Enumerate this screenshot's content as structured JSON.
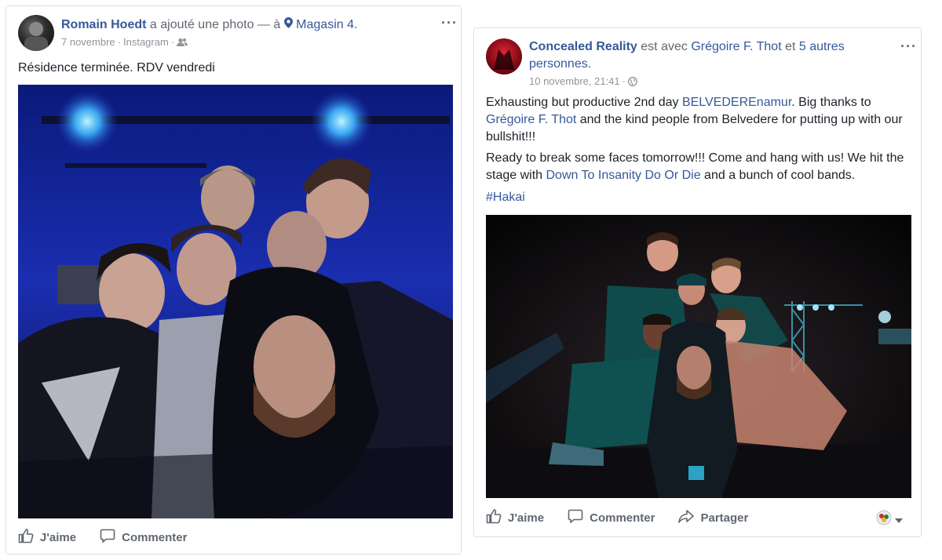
{
  "post_left": {
    "author": "Romain Hoedt",
    "action_text": "a ajouté une photo — à",
    "location": "Magasin 4.",
    "date": "7 novembre",
    "source": "Instagram",
    "text": "Résidence terminée. RDV vendredi",
    "actions": {
      "like": "J'aime",
      "comment": "Commenter"
    }
  },
  "post_right": {
    "author": "Concealed Reality",
    "with_text": "est avec",
    "tagged_person": "Grégoire F. Thot",
    "and_text": "et",
    "others": "5 autres personnes.",
    "date": "10 novembre, 21:41",
    "paragraph1": {
      "p1": "Exhausting but productive 2nd day ",
      "mention1": "BELVEDEREnamur",
      "p2": ". Big thanks to ",
      "mention2": "Grégoire F. Thot",
      "p3": " and the kind people from Belvedere for putting up with our bullshit!!!"
    },
    "paragraph2": {
      "p1": "Ready to break some faces tomorrow!!! Come and hang with us! We hit the stage with ",
      "mention": "Down To Insanity Do Or Die",
      "p2": " and a bunch of cool bands."
    },
    "hashtag": "#Hakai",
    "actions": {
      "like": "J'aime",
      "comment": "Commenter",
      "share": "Partager"
    }
  },
  "colors": {
    "link": "#365899",
    "meta": "#90949c",
    "text": "#1d2129",
    "action": "#606770"
  },
  "icons": [
    "location-pin-icon",
    "friends-audience-icon",
    "globe-icon",
    "like-icon",
    "comment-icon",
    "share-icon",
    "more-options-icon",
    "reaction-selector-icon"
  ]
}
